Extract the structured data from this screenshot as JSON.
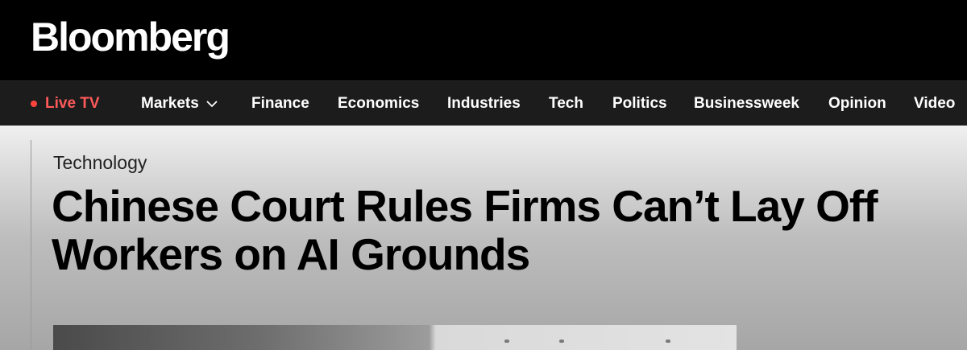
{
  "brand": {
    "logo_text": "Bloomberg"
  },
  "nav": {
    "live_label": "Live TV",
    "items": [
      {
        "label": "Markets",
        "has_dropdown": true
      },
      {
        "label": "Finance"
      },
      {
        "label": "Economics"
      },
      {
        "label": "Industries"
      },
      {
        "label": "Tech"
      },
      {
        "label": "Politics"
      },
      {
        "label": "Businessweek"
      },
      {
        "label": "Opinion"
      },
      {
        "label": "Video"
      }
    ]
  },
  "article": {
    "kicker": "Technology",
    "headline": "Chinese Court Rules Firms Can’t Lay Off Workers on AI Grounds"
  },
  "colors": {
    "masthead_bg": "#000000",
    "nav_bg": "#1c1c1c",
    "live_accent": "#ff433d"
  },
  "icons": {
    "live_indicator": "red-dot-icon",
    "dropdown": "chevron-down-icon"
  }
}
